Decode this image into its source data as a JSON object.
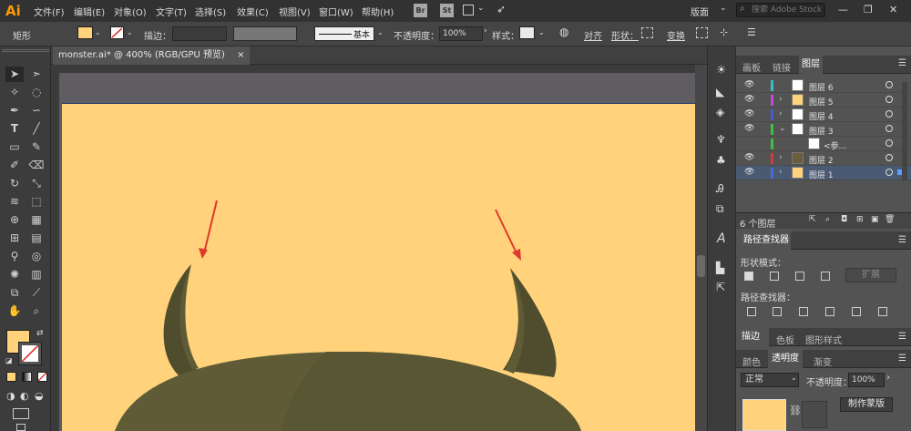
{
  "app": {
    "logo": "Ai"
  },
  "menu": [
    "文件(F)",
    "编辑(E)",
    "对象(O)",
    "文字(T)",
    "选择(S)",
    "效果(C)",
    "视图(V)",
    "窗口(W)",
    "帮助(H)"
  ],
  "menu_badges": {
    "bridge": "Br",
    "stock": "St"
  },
  "workspace": "版面",
  "search": {
    "placeholder": "搜索 Adobe Stock"
  },
  "control_bar": {
    "object_type": "矩形",
    "stroke_label": "描边：",
    "stroke_style": "基本",
    "opacity_label": "不透明度：",
    "opacity_value": "100%",
    "style_label": "样式：",
    "align_label": "对齐",
    "shape_label": "形状：",
    "transform_label": "变换"
  },
  "document_tab": {
    "title": "monster.ai* @ 400% (RGB/GPU 预览)",
    "close": "×"
  },
  "layers_panel": {
    "tabs": [
      "画板",
      "链接",
      "图层"
    ],
    "active_tab": "图层",
    "rows": [
      {
        "name": "图层 6",
        "color": "#36c0c8",
        "expandable": false
      },
      {
        "name": "图层 5",
        "color": "#c44bd4",
        "expandable": true
      },
      {
        "name": "图层 4",
        "color": "#4a58d6",
        "expandable": true
      },
      {
        "name": "图层 3",
        "color": "#3cc23c",
        "expandable": true
      },
      {
        "name": "<参...",
        "color": "#3cc23c",
        "expandable": false
      },
      {
        "name": "图层 2",
        "color": "#d43c3c",
        "expandable": true
      },
      {
        "name": "图层 1",
        "color": "#4a6ad6",
        "expandable": true
      }
    ],
    "count": "6 个图层"
  },
  "pathfinder": {
    "title": "路径查找器",
    "shape_modes_label": "形状模式：",
    "expand_button": "扩展",
    "pathfinders_label": "路径查找器："
  },
  "stroke_panel": {
    "tabs": [
      "描边",
      "色板",
      "图形样式"
    ]
  },
  "color_panel": {
    "tabs": [
      "颜色",
      "透明度",
      "渐变"
    ],
    "active_tab": "透明度",
    "blend_mode": "正常",
    "opacity_label": "不透明度：",
    "opacity_value": "100%",
    "make_mask_button": "制作蒙版"
  },
  "colors": {
    "artboard": "#ffd27b",
    "horn": "#4f4d2e",
    "arrow": "#e0392b",
    "accent_orange": "#ff9a00"
  }
}
